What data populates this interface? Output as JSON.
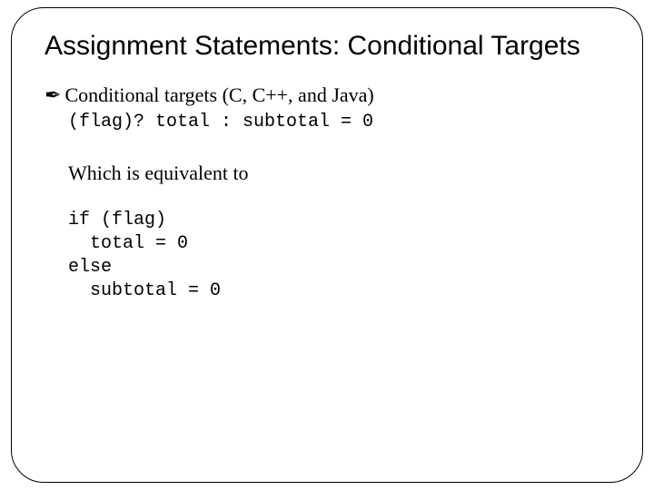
{
  "title": "Assignment Statements: Conditional Targets",
  "bullet": {
    "icon": "✒",
    "text": "Conditional targets (C, C++, and Java)"
  },
  "code1": "(flag)? total : subtotal = 0",
  "equiv": "Which is equivalent to",
  "code2": "if (flag)\n  total = 0\nelse\n  subtotal = 0"
}
